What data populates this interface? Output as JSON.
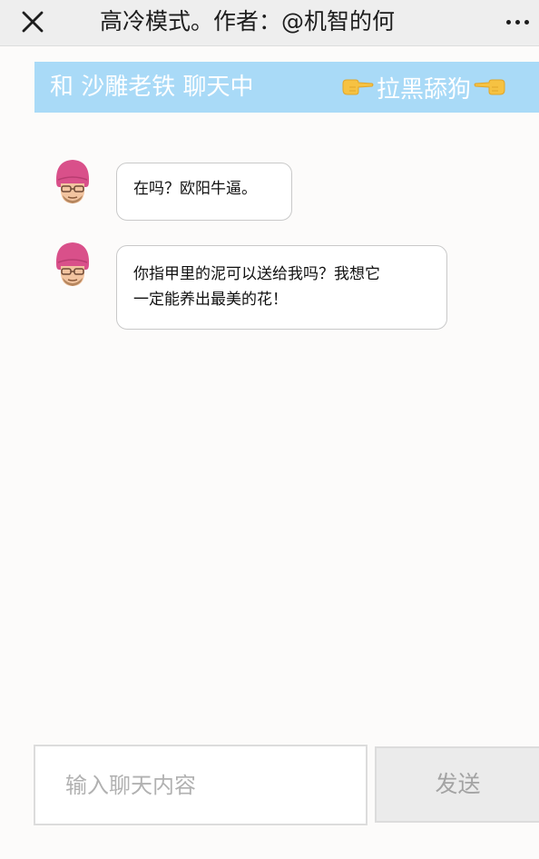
{
  "topbar": {
    "close_icon": "close-icon",
    "title": "高冷模式。作者：@机智的何",
    "more_icon": "more-dots-icon"
  },
  "banner": {
    "status_text": "和 沙雕老铁 聊天中",
    "block_label": "拉黑舔狗",
    "left_icon": "pointing-right-hand-icon",
    "right_icon": "pointing-left-hand-icon",
    "background_color": "#a9daf7"
  },
  "messages": [
    {
      "sender": "沙雕老铁",
      "avatar_icon": "memoji-avatar-icon",
      "lines": [
        "在吗？欧阳牛逼。"
      ]
    },
    {
      "sender": "沙雕老铁",
      "avatar_icon": "memoji-avatar-icon",
      "lines": [
        "你指甲里的泥可以送给我吗？我想它",
        "一定能养出最美的花！"
      ]
    }
  ],
  "composer": {
    "placeholder": "输入聊天内容",
    "value": "",
    "send_label": "发送"
  }
}
